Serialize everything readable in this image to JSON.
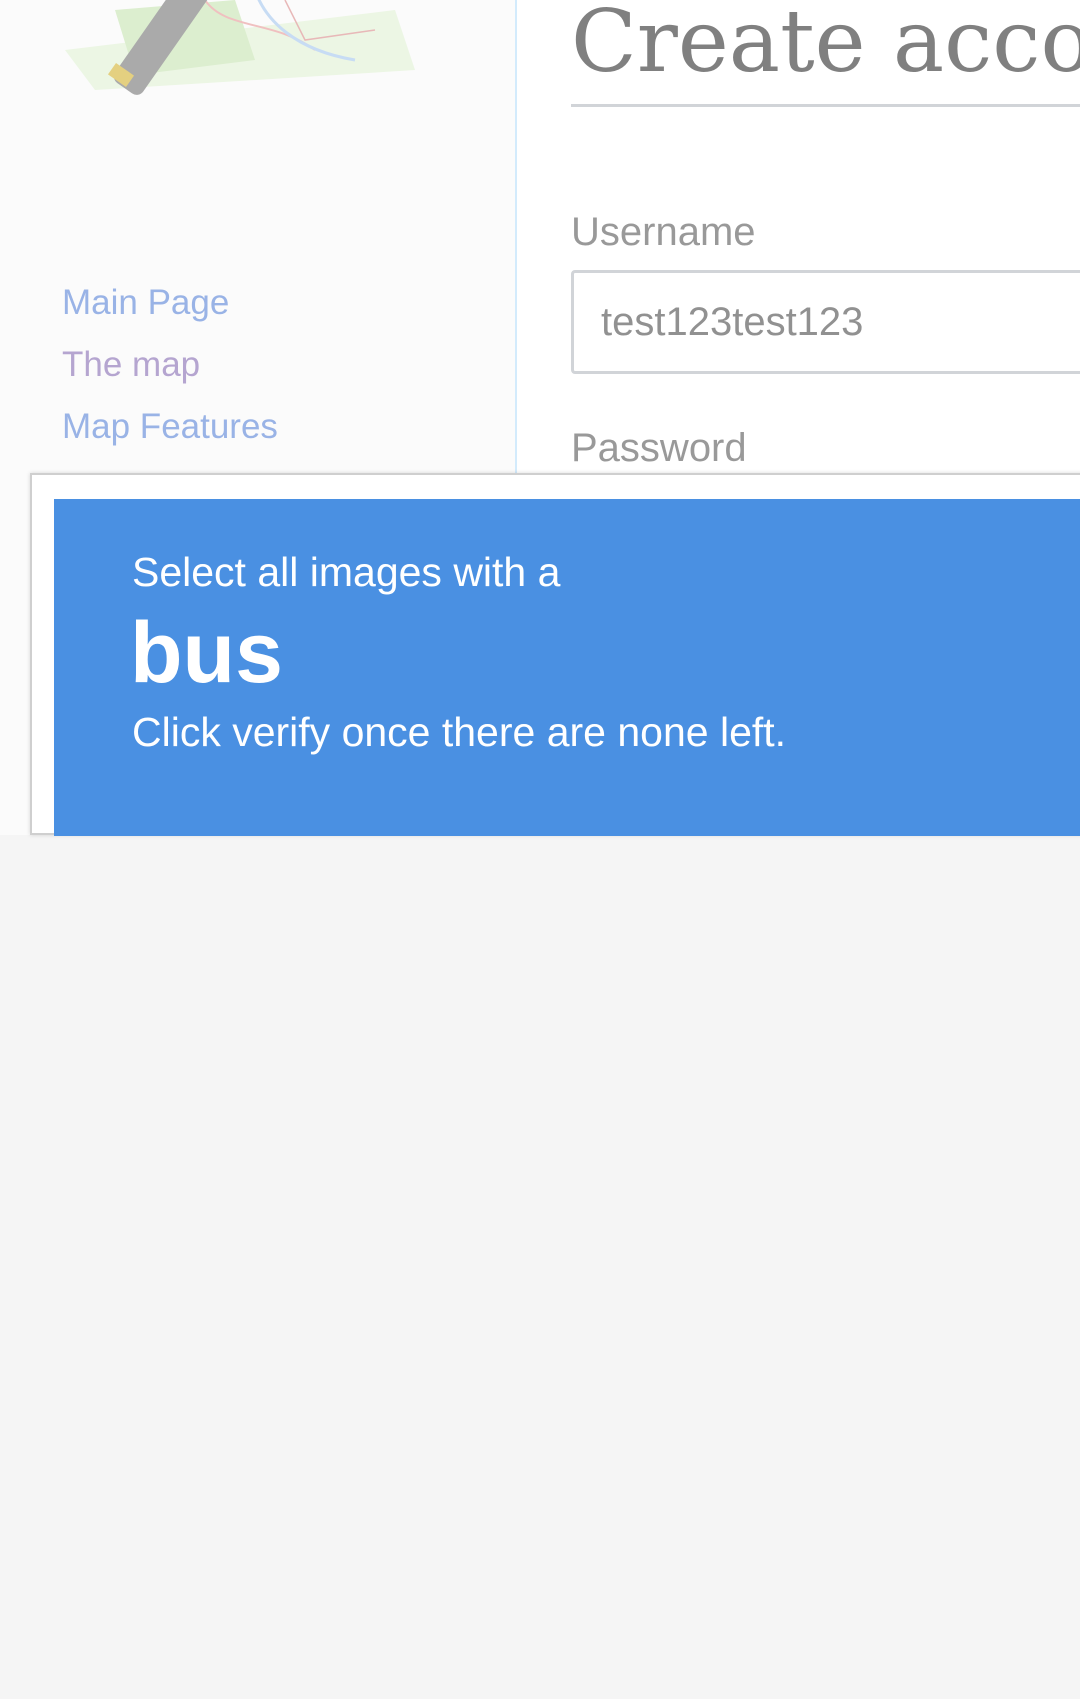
{
  "wiki": {
    "sidebar": {
      "nav": [
        {
          "label": "Main Page",
          "state": "link"
        },
        {
          "label": "The map",
          "state": "visited"
        },
        {
          "label": "Map Features",
          "state": "link"
        }
      ]
    },
    "main": {
      "heading": "Create acco",
      "username_label": "Username",
      "username_value": "test123test123",
      "password_label": "Password"
    }
  },
  "captcha": {
    "instruction_line1": "Select all images with a",
    "target": "bus",
    "instruction_line2": "Click verify once there are none left.",
    "header_color": "#4a90e2"
  },
  "icons": {
    "logo": "openstreetmap-logo"
  }
}
